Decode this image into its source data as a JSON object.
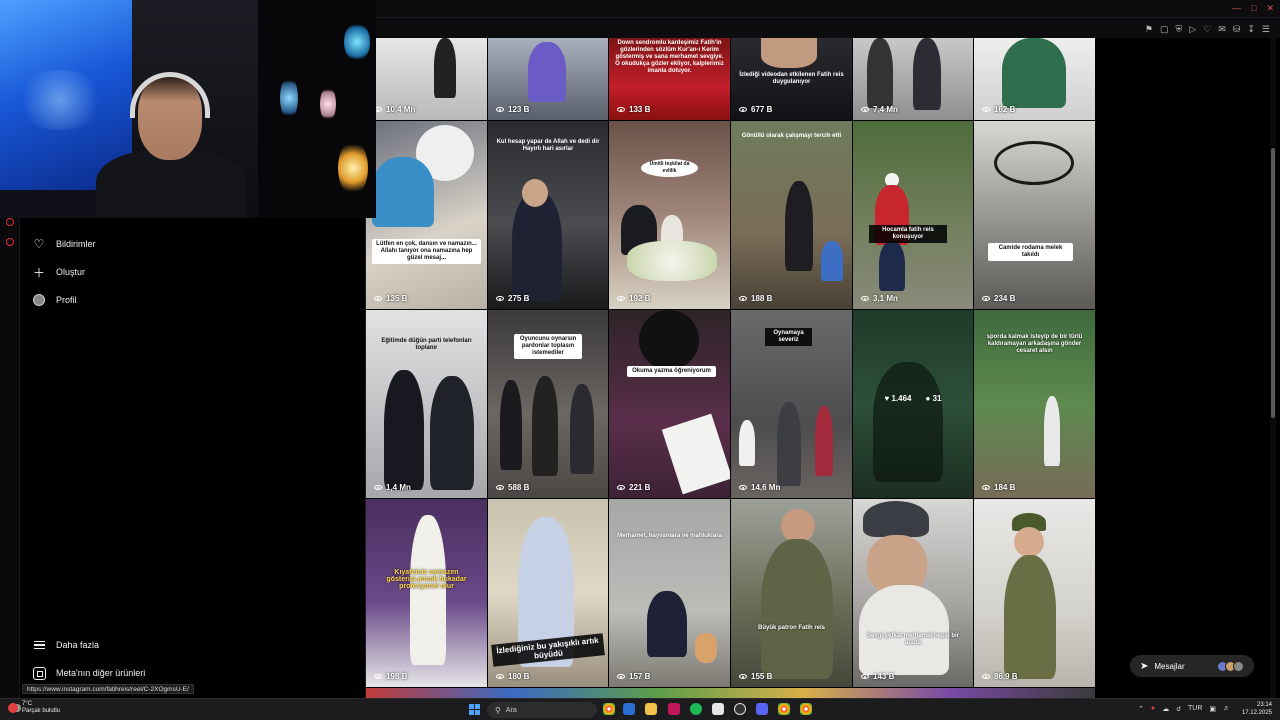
{
  "nav": {
    "items": [
      {
        "label": "Bildirimler",
        "icon": "heart-icon"
      },
      {
        "label": "Oluştur",
        "icon": "plus-icon"
      },
      {
        "label": "Profil",
        "icon": "avatar"
      }
    ],
    "bottom": [
      {
        "label": "Daha fazla",
        "icon": "menu-icon"
      },
      {
        "label": "Meta'nın diğer ürünleri",
        "icon": "meta-icon"
      }
    ]
  },
  "grid": {
    "tiles": [
      {
        "views": "10,4 Mn",
        "caption": ""
      },
      {
        "views": "123 B",
        "caption": ""
      },
      {
        "views": "133 B",
        "caption": "Down sendromlu kardeşimiz Fatih'in gözlerinden sözlüm Kur'an-ı Kerim göstermiş ve sana merhamet sevgiye. O okudukça gözler ekliyor, kalplerimiz imanla doluyor."
      },
      {
        "views": "677 B",
        "caption": "İzlediği videodan etkilenen Fatih reis duygulanıyor"
      },
      {
        "views": "7,4 Mn",
        "caption": ""
      },
      {
        "views": "162 B",
        "caption": ""
      },
      {
        "views": "135 B",
        "caption": "Lütfen en çok, dansın ve namazın... Allahı tanıyor ona namazına hep güzel mesaj..."
      },
      {
        "views": "275 B",
        "caption": "Kul hesap yapar de Allah ve dedi dir Hayırlı hari asırlar"
      },
      {
        "views": "192 B",
        "caption": "Ümitli teşkilat da evlilik"
      },
      {
        "views": "188 B",
        "caption": "Gönüllü olarak çalışmayı tercih etti"
      },
      {
        "views": "3,1 Mn",
        "caption": "Hocamla fatih reis konuşuyor"
      },
      {
        "views": "234 B",
        "caption": "Camide rodama melek takıldı"
      },
      {
        "views": "1,4 Mn",
        "caption": "Eğitimde düğün parti telefonları toplanır"
      },
      {
        "views": "588 B",
        "caption": "Oyuncunu oynarsın pardonlar toplasın istemediler"
      },
      {
        "views": "221 B",
        "caption": "Okuma yazma öğreniyorum"
      },
      {
        "views": "14,6 Mn",
        "caption": "Oynamaya severiz"
      },
      {
        "views": "",
        "caption": "",
        "likes": "1.464",
        "comments": "31"
      },
      {
        "views": "184 B",
        "caption": "sporda kalmak isteyip de bir türlü kaldıramayan arkadaşına gönder cesaret alsın"
      },
      {
        "views": "198 B",
        "caption": "Kıyafetsiz semazen gösterisi,ancak bukadar profesyonel olur"
      },
      {
        "views": "180 B",
        "caption": "İzlediğiniz bu yakışıklı artık büyüdü"
      },
      {
        "views": "157 B",
        "caption": "Merhamet, hayvanlara ve mahluklara"
      },
      {
        "views": "155 B",
        "caption": "Büyük patron Fatih reis"
      },
      {
        "views": "143 B",
        "caption": "Sevgi şefkat merhamet hepsi bir arada"
      },
      {
        "views": "86,9 B",
        "caption": ""
      }
    ]
  },
  "messages": {
    "label": "Mesajlar"
  },
  "status_url": "https://www.instagram.com/fatihreis/reel/C-2XOgmsU-E/",
  "taskbar": {
    "weather_temp": "7°C",
    "weather_desc": "Parçalı bulutlu",
    "search_placeholder": "Ara",
    "language": "TUR",
    "time": "23:14",
    "date": "17.12.2025"
  },
  "colors": {
    "accent": "#e04040",
    "background": "#000000",
    "nav_text": "#f0f0f0"
  }
}
